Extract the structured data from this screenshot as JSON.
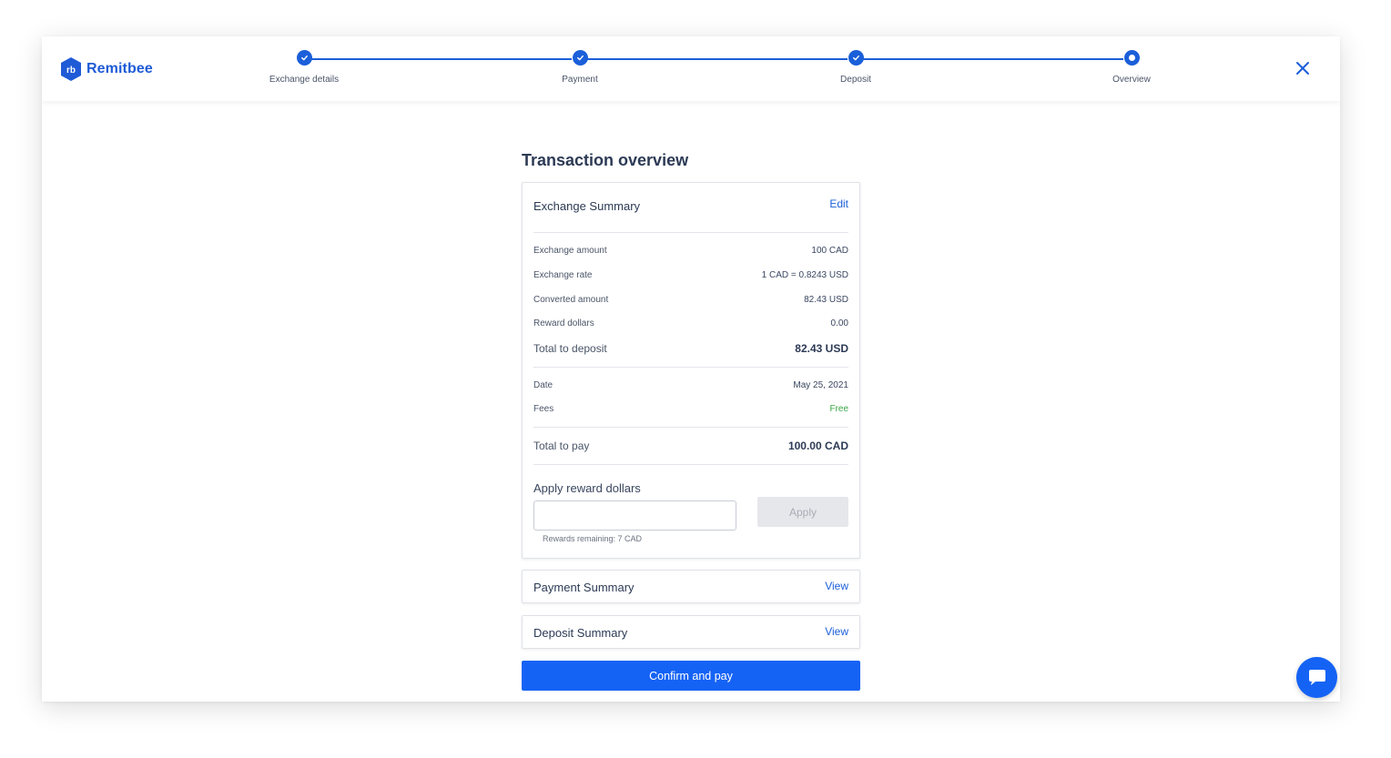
{
  "brand": {
    "name": "Remitbee",
    "color": "#1f5bd6"
  },
  "steps": [
    {
      "label": "Exchange details",
      "state": "done"
    },
    {
      "label": "Payment",
      "state": "done"
    },
    {
      "label": "Deposit",
      "state": "done"
    },
    {
      "label": "Overview",
      "state": "current"
    }
  ],
  "page_title": "Transaction overview",
  "exchange_summary": {
    "title": "Exchange Summary",
    "edit_label": "Edit",
    "rows": [
      {
        "label": "Exchange amount",
        "value": "100 CAD"
      },
      {
        "label": "Exchange rate",
        "value": "1 CAD = 0.8243 USD"
      },
      {
        "label": "Converted amount",
        "value": "82.43 USD"
      },
      {
        "label": "Reward dollars",
        "value": "0.00"
      }
    ],
    "total_deposit": {
      "label": "Total to deposit",
      "value": "82.43 USD"
    },
    "date": {
      "label": "Date",
      "value": "May 25, 2021"
    },
    "fees": {
      "label": "Fees",
      "value": "Free"
    },
    "total_pay": {
      "label": "Total to pay",
      "value": "100.00 CAD"
    },
    "reward": {
      "label": "Apply reward dollars",
      "input_value": "",
      "apply_label": "Apply",
      "remaining": "Rewards remaining: 7 CAD"
    }
  },
  "payment_summary": {
    "title": "Payment Summary",
    "link": "View"
  },
  "deposit_summary": {
    "title": "Deposit Summary",
    "link": "View"
  },
  "confirm_label": "Confirm and pay",
  "colors": {
    "primary": "#1563f5",
    "free": "#3aa845"
  }
}
